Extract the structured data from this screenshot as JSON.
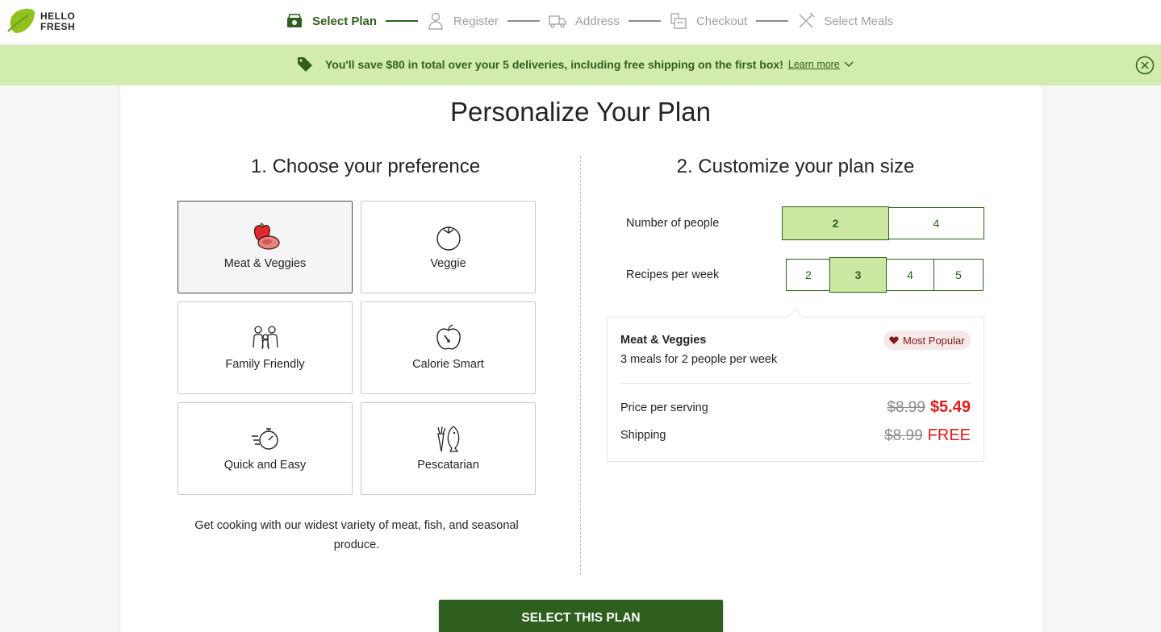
{
  "brand": {
    "line1": "HELLO",
    "line2": "FRESH",
    "accent_color": "#91c11e"
  },
  "steps": [
    {
      "label": "Select Plan",
      "icon": "plan-icon",
      "active": true
    },
    {
      "label": "Register",
      "icon": "person-icon",
      "active": false
    },
    {
      "label": "Address",
      "icon": "truck-icon",
      "active": false
    },
    {
      "label": "Checkout",
      "icon": "checkout-icon",
      "active": false
    },
    {
      "label": "Select Meals",
      "icon": "utensils-icon",
      "active": false
    }
  ],
  "banner": {
    "message": "You'll save $80 in total over your 5 deliveries, including free shipping on the first box!",
    "link": "Learn more",
    "background": "#d2ecb0"
  },
  "page_title": "Personalize Your Plan",
  "preference": {
    "title": "1. Choose your preference",
    "options": [
      {
        "label": "Meat & Veggies",
        "icon": "meat-veggies-icon",
        "selected": true
      },
      {
        "label": "Veggie",
        "icon": "tomato-icon",
        "selected": false
      },
      {
        "label": "Family Friendly",
        "icon": "family-icon",
        "selected": false
      },
      {
        "label": "Calorie Smart",
        "icon": "apple-gauge-icon",
        "selected": false
      },
      {
        "label": "Quick and Easy",
        "icon": "stopwatch-icon",
        "selected": false
      },
      {
        "label": "Pescatarian",
        "icon": "fish-carrot-icon",
        "selected": false
      }
    ],
    "description": "Get cooking with our widest variety of meat, fish, and seasonal produce."
  },
  "plan_size": {
    "title": "2. Customize your plan size",
    "people": {
      "label": "Number of people",
      "options": [
        "2",
        "4"
      ],
      "selected": "2"
    },
    "recipes": {
      "label": "Recipes per week",
      "options": [
        "2",
        "3",
        "4",
        "5"
      ],
      "selected": "3"
    }
  },
  "summary": {
    "plan_name": "Meat & Veggies",
    "plan_detail": "3 meals for 2 people per week",
    "badge": "Most Popular",
    "price_label": "Price per serving",
    "price_old": "$8.99",
    "price_new": "$5.49",
    "shipping_label": "Shipping",
    "shipping_old": "$8.99",
    "shipping_new": "FREE"
  },
  "cta": "SELECT THIS PLAN",
  "colors": {
    "primary": "#2f5f1f",
    "selected_fill": "#cde8a0",
    "sale_red": "#e3191c"
  }
}
